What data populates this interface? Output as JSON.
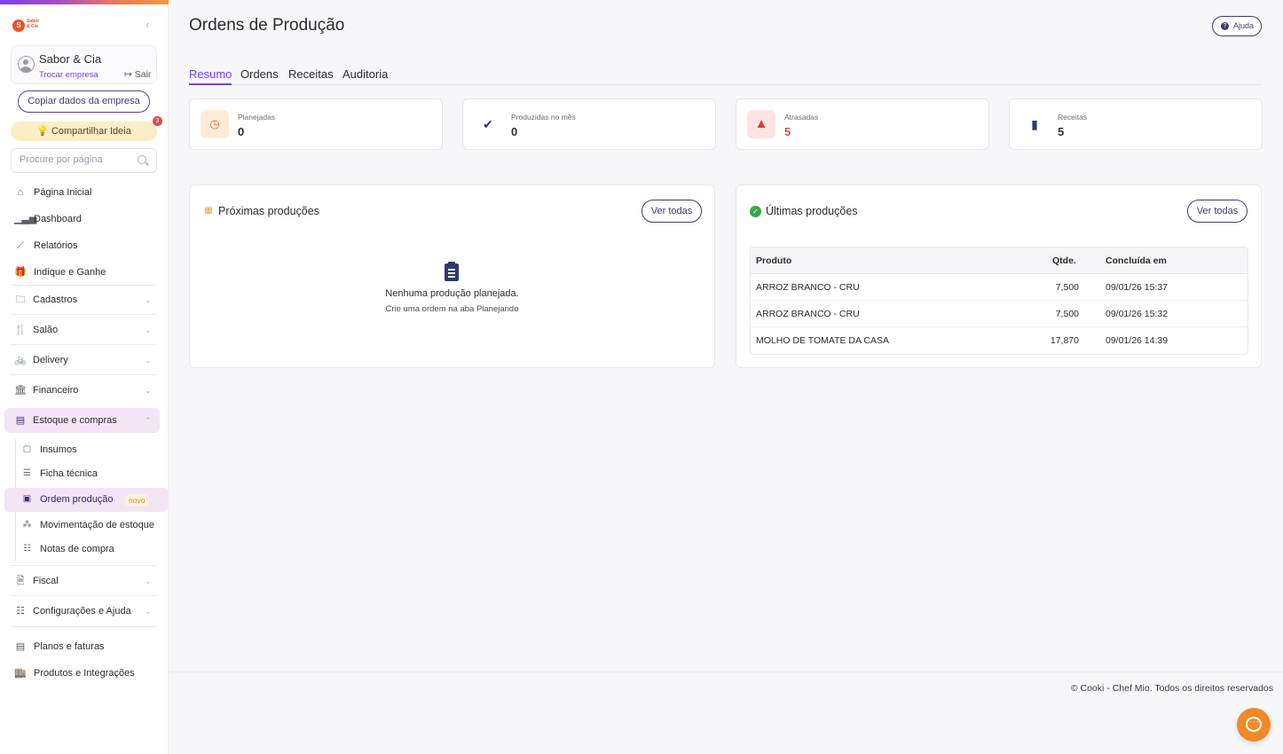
{
  "sidebar": {
    "logo": {
      "mark": "S",
      "text": "Sabor & Cia"
    },
    "company": {
      "name": "Sabor & Cia",
      "switch_label": "Trocar empresa",
      "exit_label": "Sair"
    },
    "copy_button": "Copiar dados da empresa",
    "share_button": "Compartilhar Ideia",
    "share_badge": "3",
    "search_placeholder": "Procure por página",
    "items": {
      "home": "Página Inicial",
      "dashboard": "Dashboard",
      "reports": "Relatórios",
      "refer": "Indique e Ganhe",
      "registers": "Cadastros",
      "salon": "Salão",
      "delivery": "Delivery",
      "financial": "Financeiro",
      "stock": "Estoque e compras",
      "fiscal": "Fiscal",
      "settings": "Configurações e Ajuda",
      "plans": "Planos e faturas",
      "products": "Produtos e Integrações"
    },
    "stock_sub": {
      "inputs": "Insumos",
      "datasheet": "Ficha técnica",
      "production": "Ordem produção",
      "production_badge": "novo",
      "movement": "Movimentação de estoque",
      "invoices": "Notas de compra"
    }
  },
  "header": {
    "title": "Ordens de Produção",
    "help_label": "Ajuda"
  },
  "tabs": [
    "Resumo",
    "Ordens",
    "Receitas",
    "Auditoria"
  ],
  "stats": [
    {
      "label": "Planejadas",
      "value": "0"
    },
    {
      "label": "Produzidas no mês",
      "value": "0"
    },
    {
      "label": "Atrasadas",
      "value": "5"
    },
    {
      "label": "Receitas",
      "value": "5"
    }
  ],
  "next_panel": {
    "title": "Próximas produções",
    "button": "Ver todas",
    "empty_title": "Nenhuma produção planejada.",
    "empty_hint": "Crie uma ordem na aba Planejando"
  },
  "last_panel": {
    "title": "Últimas produções",
    "button": "Ver todas",
    "columns": [
      "Produto",
      "Qtde.",
      "Concluída em"
    ],
    "rows": [
      {
        "product": "ARROZ BRANCO - CRU",
        "qty": "7,500",
        "date": "09/01/26 15:37"
      },
      {
        "product": "ARROZ BRANCO - CRU",
        "qty": "7,500",
        "date": "09/01/26 15:32"
      },
      {
        "product": "MOLHO DE TOMATE DA CASA",
        "qty": "17,870",
        "date": "09/01/26 14:39"
      }
    ]
  },
  "footer": "© Cooki - Chef Mio. Todos os direitos reservados",
  "colors": {
    "accent": "#7b3fe4",
    "danger": "#e14a4a",
    "warning": "#ef8a2a",
    "navy": "#3e3e6e"
  }
}
